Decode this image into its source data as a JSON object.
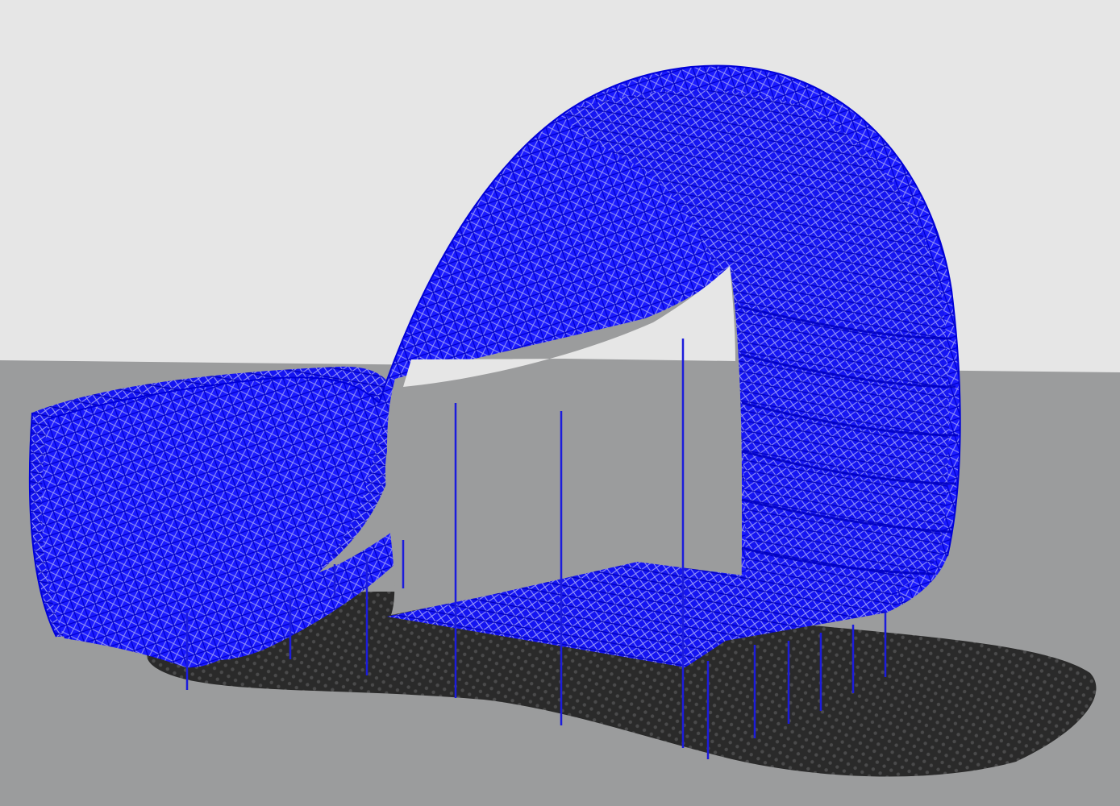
{
  "scene": {
    "colors": {
      "sky": "#e6e6e6",
      "ground": "#9b9c9d",
      "shadow": "#1a1a1a",
      "structure": "#1010ee",
      "columns": "#2020dd"
    }
  }
}
